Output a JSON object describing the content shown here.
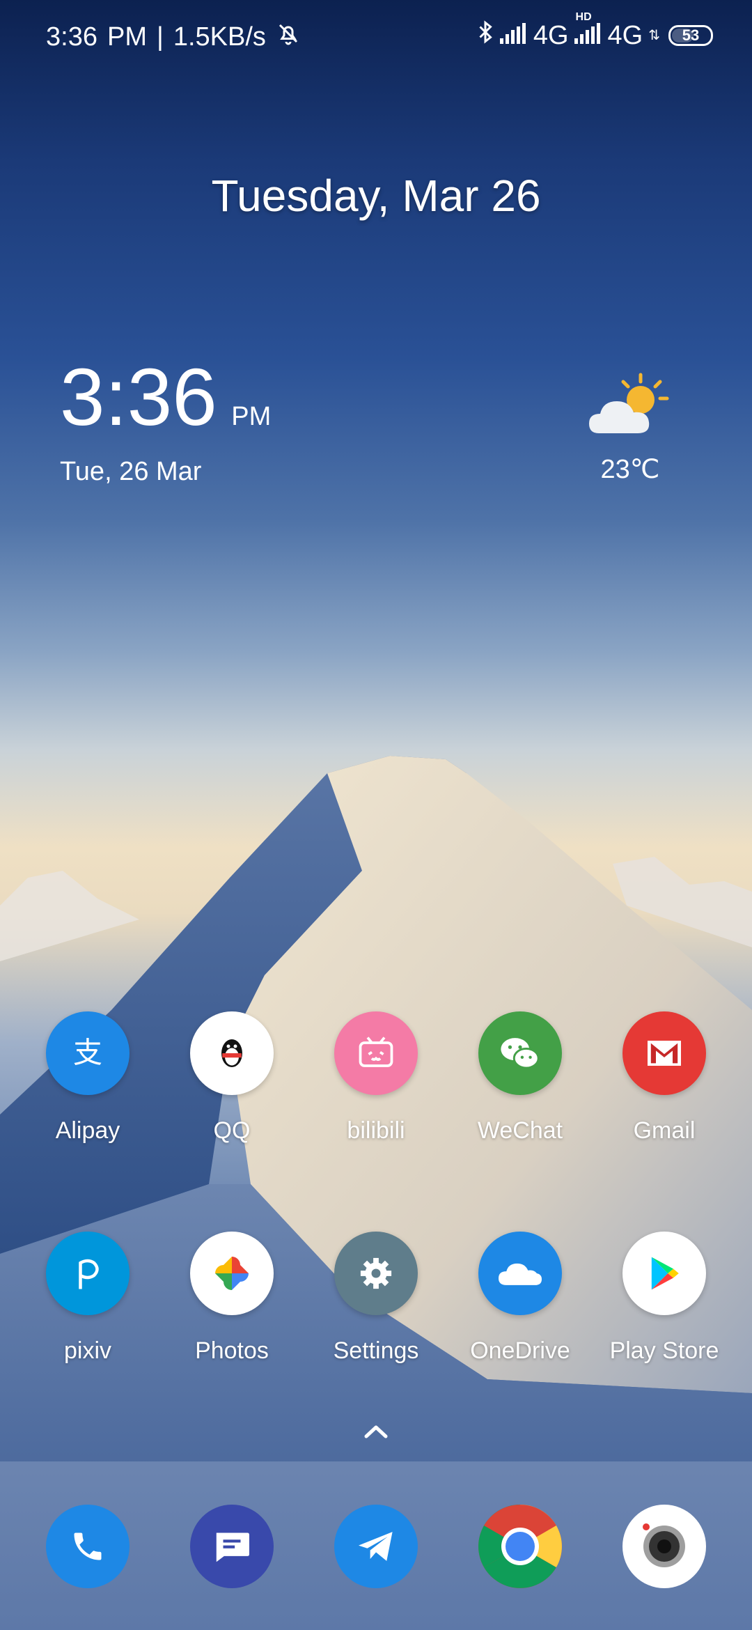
{
  "status_bar": {
    "time": "3:36",
    "ampm": "PM",
    "separator": "|",
    "network_speed": "1.5KB/s",
    "network1": "4G",
    "hd_label": "HD",
    "network2": "4G",
    "battery_level": "53",
    "icons": [
      "silent-bell-icon",
      "bluetooth-icon",
      "signal-icon",
      "signal-icon-2"
    ]
  },
  "date_heading": "Tuesday, Mar 26",
  "clock_widget": {
    "time": "3:36",
    "ampm": "PM",
    "date": "Tue, 26 Mar"
  },
  "weather_widget": {
    "icon": "partly-sunny-icon",
    "temperature": "23℃"
  },
  "home_apps": [
    {
      "label": "Alipay",
      "icon": "alipay-icon",
      "color": "#1e88e5"
    },
    {
      "label": "QQ",
      "icon": "qq-icon",
      "color": "#ffffff"
    },
    {
      "label": "bilibili",
      "icon": "bilibili-icon",
      "color": "#f47ba6"
    },
    {
      "label": "WeChat",
      "icon": "wechat-icon",
      "color": "#43a047"
    },
    {
      "label": "Gmail",
      "icon": "gmail-icon",
      "color": "#e53935"
    },
    {
      "label": "pixiv",
      "icon": "pixiv-icon",
      "color": "#0096db"
    },
    {
      "label": "Photos",
      "icon": "photos-icon",
      "color": "#ffffff"
    },
    {
      "label": "Settings",
      "icon": "gear-icon",
      "color": "#5f7d8b"
    },
    {
      "label": "OneDrive",
      "icon": "cloud-icon",
      "color": "#1e88e5"
    },
    {
      "label": "Play Store",
      "icon": "play-store-icon",
      "color": "#ffffff"
    }
  ],
  "dock_apps": [
    {
      "icon": "phone-icon",
      "color": "#1e88e5"
    },
    {
      "icon": "messages-icon",
      "color": "#3949ab"
    },
    {
      "icon": "telegram-icon",
      "color": "#1e88e5"
    },
    {
      "icon": "chrome-icon",
      "color": "#ffffff"
    },
    {
      "icon": "camera-icon",
      "color": "#ffffff"
    }
  ]
}
